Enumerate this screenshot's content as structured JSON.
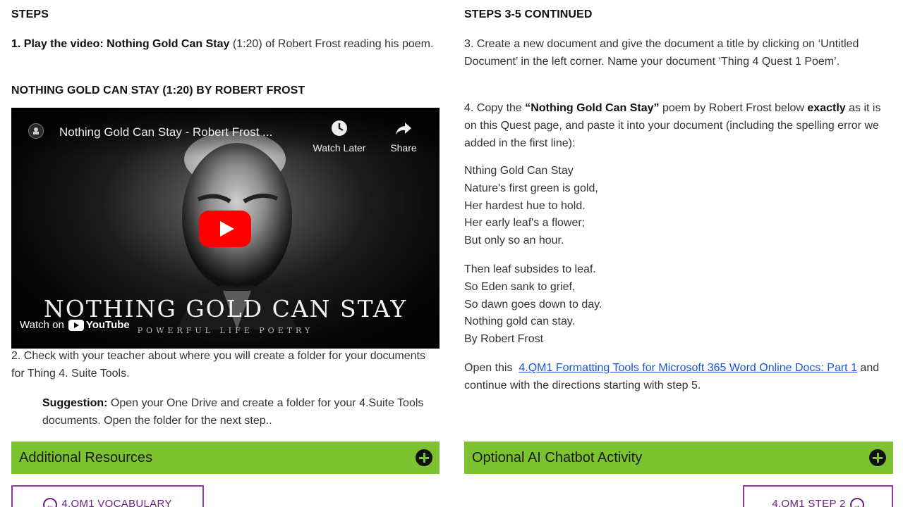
{
  "left": {
    "heading": "STEPS",
    "step1": {
      "number": "1.",
      "action": "Play the video:",
      "title": "Nothing Gold Can Stay",
      "duration": "(1:20)",
      "rest": "of Robert Frost reading his poem."
    },
    "video_heading": "NOTHING GOLD CAN STAY (1:20) BY ROBERT FROST",
    "video": {
      "title": "Nothing Gold Can Stay - Robert Frost ...",
      "watch_later": "Watch Later",
      "share": "Share",
      "overlay_title": "NOTHING GOLD CAN STAY",
      "overlay_subtitle": "POWERFUL LIFE POETRY",
      "watch_on": "Watch on",
      "youtube": "YouTube"
    },
    "step2": "2. Check with your teacher about where you will create a folder for your documents for Thing 4. Suite Tools.",
    "suggestion_label": "Suggestion:",
    "suggestion_text": "Open your One Drive and create a folder for your 4.Suite Tools documents. Open the folder for the next step..",
    "accordion_label": "Additional Resources",
    "nav_prev": "4.QM1 VOCABULARY"
  },
  "right": {
    "heading": "STEPS 3-5 CONTINUED",
    "step3": "3. Create a new document and give the document a title by clicking on ‘Untitled Document’ in the left corner. Name your document ‘Thing 4 Quest 1 Poem’.",
    "step4": {
      "prefix": "4. Copy the",
      "title": "“Nothing Gold Can Stay”",
      "middle": "poem by Robert Frost below",
      "emph": "exactly",
      "suffix": "as it is on this Quest page, and paste it into your document (including the spelling error we added in the first line):"
    },
    "poem_stanza1": [
      "Nthing Gold Can Stay",
      "Nature's first green is gold,",
      "Her hardest hue to hold.",
      "Her early leaf's a flower;",
      "But only so an hour."
    ],
    "poem_stanza2": [
      "Then leaf subsides to leaf.",
      "So Eden sank to grief,",
      "So dawn goes down to day.",
      "Nothing gold can stay.",
      "By Robert Frost"
    ],
    "step5": {
      "prefix": "Open this",
      "link": "4.QM1 Formatting Tools for Microsoft 365 Word Online Docs: Part 1",
      "suffix": "and continue with the directions starting with step 5."
    },
    "accordion_label": "Optional AI Chatbot Activity",
    "nav_next": "4.QM1 STEP 2"
  },
  "colors": {
    "accent_green": "#7cc231",
    "nav_purple": "#6b1f86",
    "link_blue": "#1a55d6",
    "youtube_red": "#ff0000"
  },
  "icons": [
    "youtube-channel-icon",
    "watch-later-icon",
    "share-icon",
    "play-button-icon",
    "plus-circle-icon",
    "arrow-left-circle-icon",
    "arrow-right-circle-icon"
  ]
}
